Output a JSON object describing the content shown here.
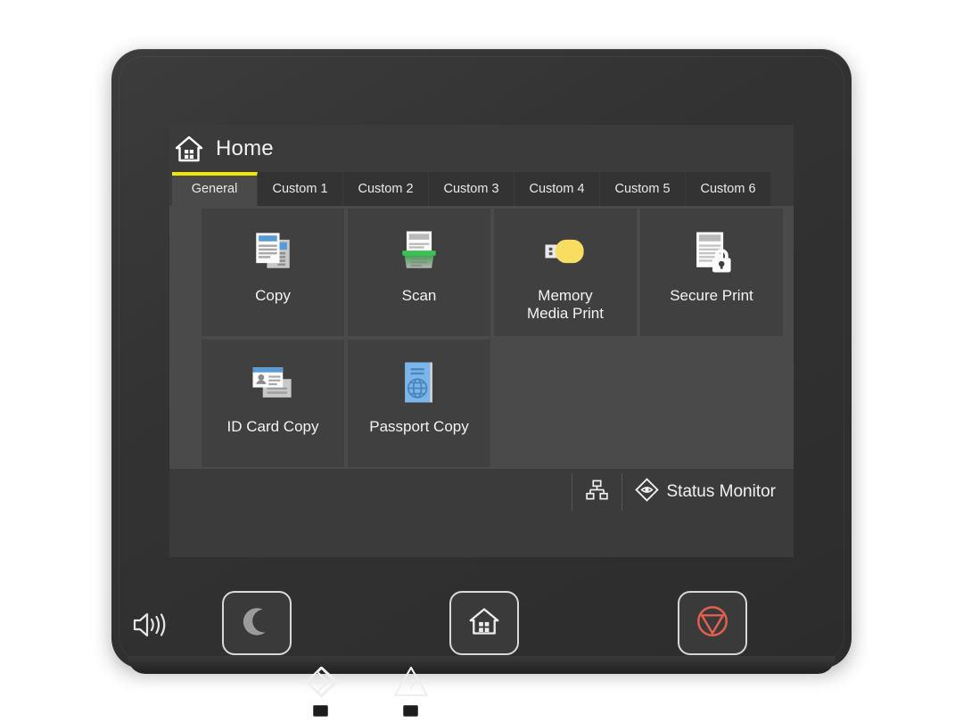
{
  "device": {
    "type": "printer-control-panel",
    "shell_color": "#333333",
    "screen_bg": "#3b3b3b",
    "accent_color": "#f2e600"
  },
  "screen": {
    "header": {
      "icon": "home-icon",
      "title": "Home"
    },
    "tabs": [
      {
        "label": "General",
        "active": true
      },
      {
        "label": "Custom 1",
        "active": false
      },
      {
        "label": "Custom 2",
        "active": false
      },
      {
        "label": "Custom 3",
        "active": false
      },
      {
        "label": "Custom 4",
        "active": false
      },
      {
        "label": "Custom 5",
        "active": false
      },
      {
        "label": "Custom 6",
        "active": false
      }
    ],
    "tiles": [
      {
        "label": "Copy",
        "icon": "copy-documents-icon",
        "accent": "#5b9bd5"
      },
      {
        "label": "Scan",
        "icon": "scanner-icon",
        "accent": "#3cb54a"
      },
      {
        "label": "Memory\nMedia Print",
        "icon": "usb-drive-icon",
        "accent": "#f7dd62"
      },
      {
        "label": "Secure Print",
        "icon": "document-lock-icon",
        "accent": "#ffffff"
      },
      {
        "label": "ID Card Copy",
        "icon": "id-card-icon",
        "accent": "#5b9bd5"
      },
      {
        "label": "Passport Copy",
        "icon": "passport-globe-icon",
        "accent": "#7cb6e8"
      }
    ],
    "statusbar": {
      "network_icon": "network-sitemap-icon",
      "status_monitor_icon": "status-monitor-eye-icon",
      "status_monitor_label": "Status Monitor"
    }
  },
  "hardware": {
    "speaker_icon": "speaker-volume-icon",
    "buttons": [
      {
        "name": "energy-saver",
        "icon": "moon-icon"
      },
      {
        "name": "home",
        "icon": "home-house-icon"
      },
      {
        "name": "stop",
        "icon": "stop-triangle-icon",
        "color": "#e1604f"
      }
    ],
    "indicators": [
      {
        "name": "data-indicator",
        "icon": "arrow-into-diamond-icon"
      },
      {
        "name": "error-indicator",
        "icon": "warning-triangle-icon"
      }
    ]
  }
}
